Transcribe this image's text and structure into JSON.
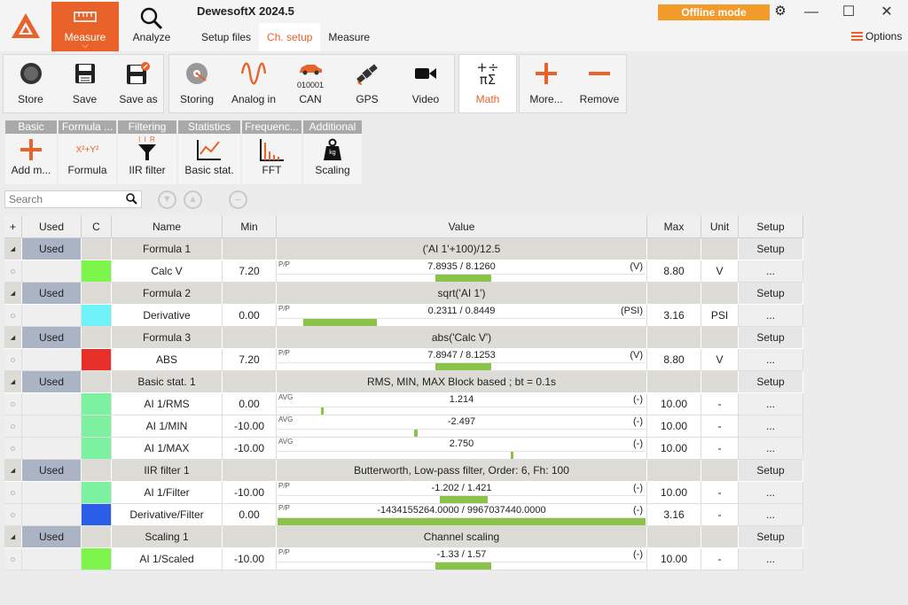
{
  "app": {
    "title": "DewesoftX 2024.5",
    "offline_label": "Offline mode",
    "options_label": "Options",
    "nav": [
      {
        "label": "Measure",
        "icon": "measure-ruler-icon",
        "active": true
      },
      {
        "label": "Analyze",
        "icon": "magnifier-icon",
        "active": false
      }
    ],
    "subtabs": [
      {
        "label": "Setup files",
        "active": false
      },
      {
        "label": "Ch. setup",
        "active": true
      },
      {
        "label": "Measure",
        "active": false
      }
    ]
  },
  "toolbar": {
    "file_group": [
      {
        "label": "Store",
        "icon": "record-circle-icon"
      },
      {
        "label": "Save",
        "icon": "save-disk-icon"
      },
      {
        "label": "Save as",
        "icon": "save-as-disk-icon"
      }
    ],
    "channels_group": [
      {
        "label": "Storing",
        "icon": "storage-disk-icon"
      },
      {
        "label": "Analog in",
        "icon": "sine-wave-icon"
      },
      {
        "label": "CAN",
        "icon": "car-icon",
        "sublabel": "010001"
      },
      {
        "label": "GPS",
        "icon": "satellite-icon"
      },
      {
        "label": "Video",
        "icon": "video-camera-icon"
      }
    ],
    "math_group": {
      "label": "Math",
      "icon": "math-symbols-icon",
      "active": true
    },
    "edit_group": [
      {
        "label": "More...",
        "icon": "plus-icon"
      },
      {
        "label": "Remove",
        "icon": "minus-icon"
      }
    ]
  },
  "math_toolbar": [
    {
      "header": "Basic",
      "label": "Add m...",
      "icon": "plus-icon"
    },
    {
      "header": "Formula ...",
      "label": "Formula",
      "icon": "formula-icon",
      "glyph": "X²+Y²"
    },
    {
      "header": "Filtering",
      "label": "IIR filter",
      "icon": "funnel-filter-icon",
      "glyph": "I I R"
    },
    {
      "header": "Statistics",
      "label": "Basic stat.",
      "icon": "chart-line-icon"
    },
    {
      "header": "Frequenc...",
      "label": "FFT",
      "icon": "fft-bars-icon"
    },
    {
      "header": "Additional",
      "label": "Scaling",
      "icon": "weight-kg-icon",
      "glyph": "kg"
    }
  ],
  "search": {
    "placeholder": "Search"
  },
  "table": {
    "headers": {
      "add": "+",
      "used": "Used",
      "color": "C",
      "name": "Name",
      "min": "Min",
      "value": "Value",
      "max": "Max",
      "unit": "Unit",
      "setup": "Setup"
    },
    "rows": [
      {
        "type": "group",
        "used": "Used",
        "name": "Formula 1",
        "value": "('AI 1'+100)/12.5",
        "setup": "Setup"
      },
      {
        "type": "channel",
        "color": "#7ef54a",
        "name": "Calc V",
        "min": "7.20",
        "vlabel": "P/P",
        "value": "7.8935 / 8.1260",
        "vunit": "(V)",
        "bar_from": 0.43,
        "bar_to": 0.58,
        "max": "8.80",
        "unit": "V",
        "setup": "..."
      },
      {
        "type": "group",
        "used": "Used",
        "name": "Formula 2",
        "value": "sqrt('AI 1')",
        "setup": "Setup"
      },
      {
        "type": "channel",
        "color": "#6ff2f8",
        "name": "Derivative",
        "min": "0.00",
        "vlabel": "P/P",
        "value": "0.2311 / 0.8449",
        "vunit": "(PSI)",
        "bar_from": 0.07,
        "bar_to": 0.27,
        "max": "3.16",
        "unit": "PSI",
        "setup": "..."
      },
      {
        "type": "group",
        "used": "Used",
        "name": "Formula 3",
        "value": "abs('Calc V')",
        "setup": "Setup"
      },
      {
        "type": "channel",
        "color": "#e8302a",
        "name": "ABS",
        "min": "7.20",
        "vlabel": "P/P",
        "value": "7.8947 / 8.1253",
        "vunit": "(V)",
        "bar_from": 0.43,
        "bar_to": 0.58,
        "max": "8.80",
        "unit": "V",
        "setup": "..."
      },
      {
        "type": "group",
        "used": "Used",
        "name": "Basic stat. 1",
        "value": "RMS, MIN, MAX Block based ; bt = 0.1s",
        "setup": "Setup"
      },
      {
        "type": "channel",
        "color": "#7cf2a0",
        "name": "AI 1/RMS",
        "min": "0.00",
        "vlabel": "AVG",
        "value": "1.214",
        "vunit": "(-)",
        "bar_from": 0.118,
        "bar_to": 0.126,
        "max": "10.00",
        "unit": "-",
        "setup": "..."
      },
      {
        "type": "channel",
        "color": "#7cf2a0",
        "name": "AI 1/MIN",
        "min": "-10.00",
        "vlabel": "AVG",
        "value": "-2.497",
        "vunit": "(-)",
        "bar_from": 0.372,
        "bar_to": 0.38,
        "max": "10.00",
        "unit": "-",
        "setup": "..."
      },
      {
        "type": "channel",
        "color": "#7cf2a0",
        "name": "AI 1/MAX",
        "min": "-10.00",
        "vlabel": "AVG",
        "value": "2.750",
        "vunit": "(-)",
        "bar_from": 0.634,
        "bar_to": 0.642,
        "max": "10.00",
        "unit": "-",
        "setup": "..."
      },
      {
        "type": "group",
        "used": "Used",
        "name": "IIR filter 1",
        "value": "Butterworth,  Low-pass filter, Order: 6,  Fh: 100",
        "setup": "Setup"
      },
      {
        "type": "channel",
        "color": "#7cf2a0",
        "name": "AI 1/Filter",
        "min": "-10.00",
        "vlabel": "P/P",
        "value": "-1.202 / 1.421",
        "vunit": "(-)",
        "bar_from": 0.44,
        "bar_to": 0.57,
        "max": "10.00",
        "unit": "-",
        "setup": "..."
      },
      {
        "type": "channel",
        "color": "#2a5ee8",
        "name": "Derivative/Filter",
        "min": "0.00",
        "vlabel": "P/P",
        "value": "-1434155264.0000 / 9967037440.0000",
        "vunit": "(-)",
        "bar_from": 0.0,
        "bar_to": 1.0,
        "max": "3.16",
        "unit": "-",
        "setup": "..."
      },
      {
        "type": "group",
        "used": "Used",
        "name": "Scaling 1",
        "value": "Channel scaling",
        "setup": "Setup"
      },
      {
        "type": "channel",
        "color": "#7ef54a",
        "name": "AI 1/Scaled",
        "min": "-10.00",
        "vlabel": "P/P",
        "value": "-1.33 / 1.57",
        "vunit": "(-)",
        "bar_from": 0.43,
        "bar_to": 0.58,
        "max": "10.00",
        "unit": "-",
        "setup": "..."
      }
    ]
  }
}
